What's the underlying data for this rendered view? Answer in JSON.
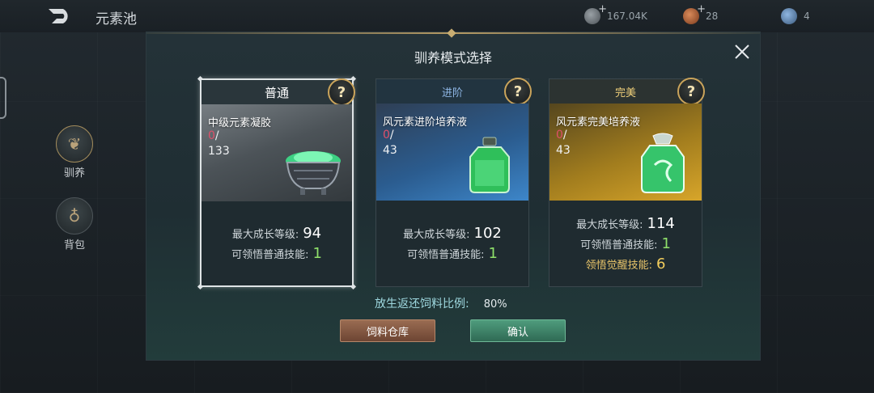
{
  "topbar": {
    "title": "元素池",
    "resources": [
      {
        "icon": "silver-coin-icon",
        "value": "167.04K",
        "plus": "+"
      },
      {
        "icon": "copper-coin-icon",
        "value": "28",
        "plus": "+"
      },
      {
        "icon": "blue-gem-icon",
        "value": "4"
      }
    ]
  },
  "side_nav": [
    {
      "label": "驯养",
      "icon": "creature-icon"
    },
    {
      "label": "背包",
      "icon": "bag-icon"
    }
  ],
  "modal": {
    "title": "驯养模式选择",
    "close_icon": "close-icon",
    "cards": [
      {
        "mode": "普通",
        "selected": true,
        "help": "?",
        "item_name": "中级元素凝胶",
        "have": "0",
        "sep": "/",
        "need": "133",
        "item_icon": "green-gel-cauldron-icon",
        "stats": [
          {
            "label": "最大成长等级:",
            "value": "94"
          },
          {
            "label": "可领悟普通技能:",
            "value": "1"
          }
        ]
      },
      {
        "mode": "进阶",
        "selected": false,
        "help": "?",
        "item_name": "风元素进阶培养液",
        "have": "0",
        "sep": "/",
        "need": "43",
        "item_icon": "green-potion-bottle-icon",
        "stats": [
          {
            "label": "最大成长等级:",
            "value": "102"
          },
          {
            "label": "可领悟普通技能:",
            "value": "1"
          }
        ]
      },
      {
        "mode": "完美",
        "selected": false,
        "help": "?",
        "item_name": "风元素完美培养液",
        "have": "0",
        "sep": "/",
        "need": "43",
        "item_icon": "ornate-green-potion-icon",
        "stats": [
          {
            "label": "最大成长等级:",
            "value": "114"
          },
          {
            "label": "可领悟普通技能:",
            "value": "1"
          },
          {
            "label": "领悟觉醒技能:",
            "value": "6"
          }
        ]
      }
    ],
    "release_ratio_label": "放生返还饲料比例:",
    "release_ratio_value": "80%",
    "buttons": {
      "store": "饲料仓库",
      "confirm": "确认"
    }
  }
}
